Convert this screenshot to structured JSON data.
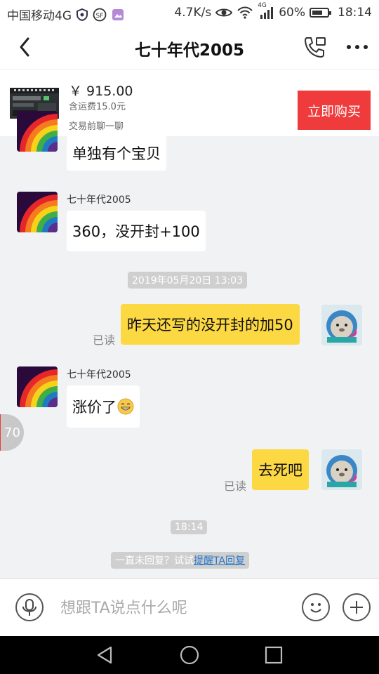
{
  "status_bar": {
    "carrier": "中国移动4G",
    "speed": "4.7K/s",
    "network": "4G",
    "battery": "60%",
    "time": "18:14"
  },
  "header": {
    "title": "七十年代2005"
  },
  "product": {
    "price": "￥ 915.00",
    "shipping": "含运费15.0元",
    "consult": "交易前聊一聊",
    "buy_label": "立即购买"
  },
  "messages": {
    "m1": {
      "text": "单独有个宝贝"
    },
    "m2": {
      "sender": "七十年代2005",
      "text": "360，没开封+100"
    },
    "ts1": "2019年05月20日 13:03",
    "m3": {
      "text": "昨天还写的没开封的加50",
      "status": "已读"
    },
    "m4": {
      "sender": "七十年代2005",
      "text": "涨价了"
    },
    "m5": {
      "text": "去死吧",
      "status": "已读"
    },
    "ts2": "18:14",
    "hint": {
      "prefix": "一直未回复？试试",
      "link": "提醒TA回复"
    }
  },
  "side_badge": "70",
  "input": {
    "placeholder": "想跟TA说点什么呢"
  },
  "colors": {
    "buy_button": "#ef3b3b",
    "my_bubble": "#fcd843",
    "link": "#2b78c8"
  }
}
